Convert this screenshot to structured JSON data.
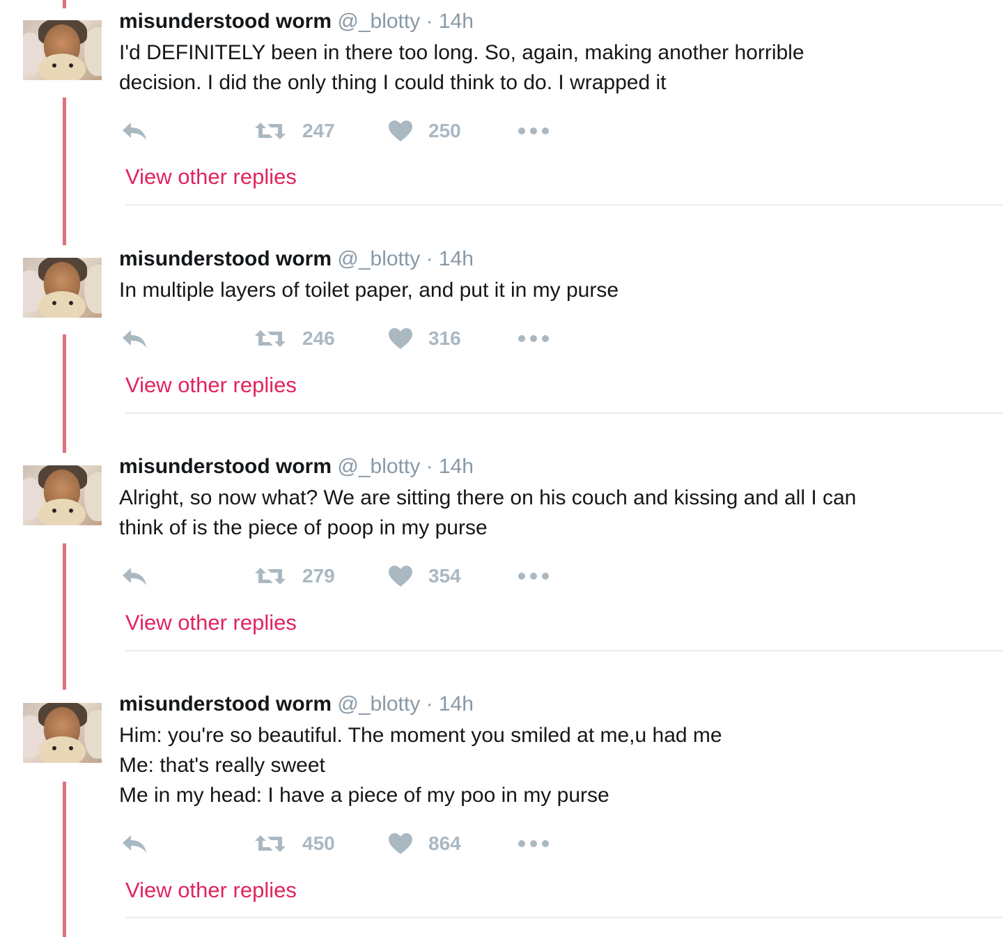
{
  "colors": {
    "thread_line": "#e0707c",
    "link": "#e0245e",
    "muted": "#8899a6",
    "action": "#aab8c2",
    "divider": "#e6ecf0"
  },
  "tweets": [
    {
      "name": "misunderstood worm",
      "handle": "@_blotty",
      "separator": "·",
      "time": "14h",
      "text": "I'd DEFINITELY been in there too long. So, again, making another horrible\ndecision. I did the only thing I could think to do. I wrapped it",
      "retweets": "247",
      "likes": "250",
      "view_replies": "View other replies"
    },
    {
      "name": "misunderstood worm",
      "handle": "@_blotty",
      "separator": "·",
      "time": "14h",
      "text": "In multiple layers of toilet paper, and put it in my purse",
      "retweets": "246",
      "likes": "316",
      "view_replies": "View other replies"
    },
    {
      "name": "misunderstood worm",
      "handle": "@_blotty",
      "separator": "·",
      "time": "14h",
      "text": "Alright, so now what? We are sitting there on his couch and kissing and all I can\nthink of is the piece of poop in my purse",
      "retweets": "279",
      "likes": "354",
      "view_replies": "View other replies"
    },
    {
      "name": "misunderstood worm",
      "handle": "@_blotty",
      "separator": "·",
      "time": "14h",
      "text": "Him: you're so beautiful. The moment you smiled at me,u had me\nMe: that's really sweet\nMe in my head: I have a piece of my poo in my purse",
      "retweets": "450",
      "likes": "864",
      "view_replies": "View other replies"
    }
  ],
  "icons": {
    "reply": "reply-icon",
    "retweet": "retweet-icon",
    "like": "heart-icon",
    "more": "more-icon"
  }
}
